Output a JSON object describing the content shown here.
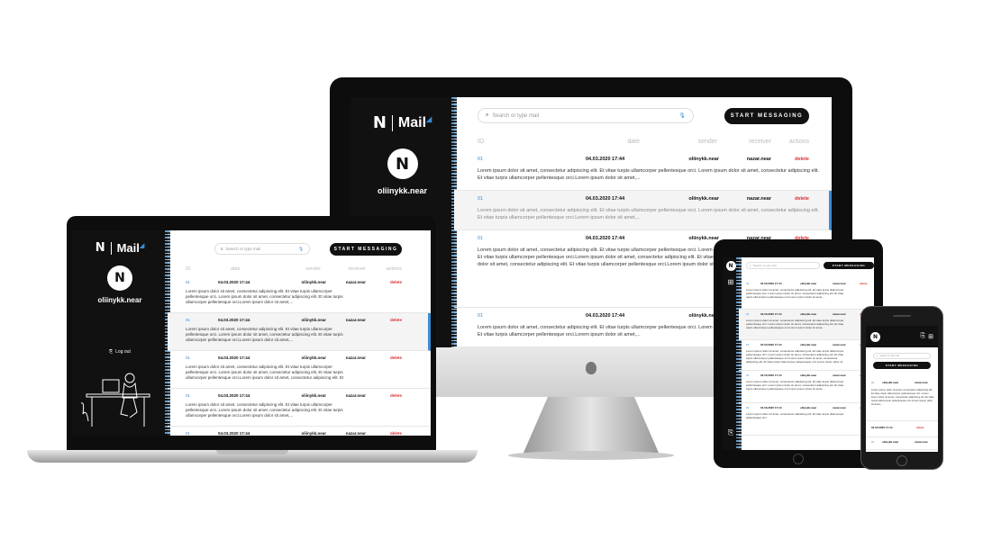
{
  "app": {
    "logo_n": "N",
    "logo_small": "NEAR",
    "logo_text": "Mail",
    "logo_mark": "◢",
    "avatar_glyph": "N",
    "username": "oliinykk.near",
    "logout_label": "Log out",
    "search_placeholder": "Search or type mail",
    "search_icon": "search-icon",
    "mic_icon": "microphone-icon",
    "start_label": "START MESSAGING"
  },
  "table": {
    "headers": [
      "ID",
      "date",
      "sender",
      "receiver",
      "actions"
    ],
    "rows": [
      {
        "id": "01",
        "date": "04.03.2020 17:44",
        "sender": "oliinykk.near",
        "receiver": "nazar.near",
        "action": "delete",
        "text": "Lorem ipsum dolor sit amet, consectetur adipiscing elit. Et vitae turpis ullamcorper pellentesque orci. Lorem ipsum dolor sit amet, consectetur adipiscing elit. Et vitae turpis ullamcorper pellentesque orci.Lorem ipsum dolor sit amet,..."
      },
      {
        "id": "01",
        "date": "04.03.2020 17:44",
        "sender": "oliinykk.near",
        "receiver": "nazar.near",
        "action": "delete",
        "text": "Lorem ipsum dolor sit amet, consectetur adipiscing elit. Et vitae turpis ullamcorper pellentesque orci. Lorem ipsum dolor sit amet, consectetur adipiscing elit. Et vitae turpis ullamcorper pellentesque orci.Lorem ipsum dolor sit amet,..."
      },
      {
        "id": "01",
        "date": "04.03.2020 17:44",
        "sender": "oliinykk.near",
        "receiver": "nazar.near",
        "action": "delete",
        "text": "Lorem ipsum dolor sit amet, consectetur adipiscing elit. Et vitae turpis ullamcorper pellentesque orci. Lorem ipsum dolor sit amet, consectetur adipiscing elit. Et vitae turpis ullamcorper pellentesque orci.Lorem ipsum dolor sit amet, consectetur adipiscing elit. Et vitae turpis ullamcorper pellentesque orci.Lorem ipsum dolor sit amet, consectetur adipiscing elit. Et vitae turpis ullamcorper pellentesque orci.Lorem ipsum dolor sit amet,..."
      },
      {
        "id": "01",
        "date": "04.03.2020 17:44",
        "sender": "oliinykk.near",
        "receiver": "nazar.near",
        "action": "delete",
        "text": "Lorem ipsum dolor sit amet, consectetur adipiscing elit. Et vitae turpis ullamcorper pellentesque orci. Lorem ipsum dolor sit amet, consectetur adipiscing elit. Et vitae turpis ullamcorper pellentesque orci.Lorem ipsum dolor sit amet,..."
      },
      {
        "id": "01",
        "date": "04.03.2020 17:44",
        "sender": "oliinykk.near",
        "receiver": "nazar.near",
        "action": "delete",
        "text": "Lorem ipsum dolor sit amet, consectetur adipiscing elit. Et vitae turpis ullamcorper pellentesque orci."
      }
    ]
  },
  "colors": {
    "accent": "#3b8bd4",
    "danger": "#d62e2e",
    "sidebar": "#111111"
  },
  "icons": {
    "apple": "apple-logo-icon",
    "grid": "grid-icon",
    "logout": "logout-icon",
    "trash": "trash-icon"
  }
}
